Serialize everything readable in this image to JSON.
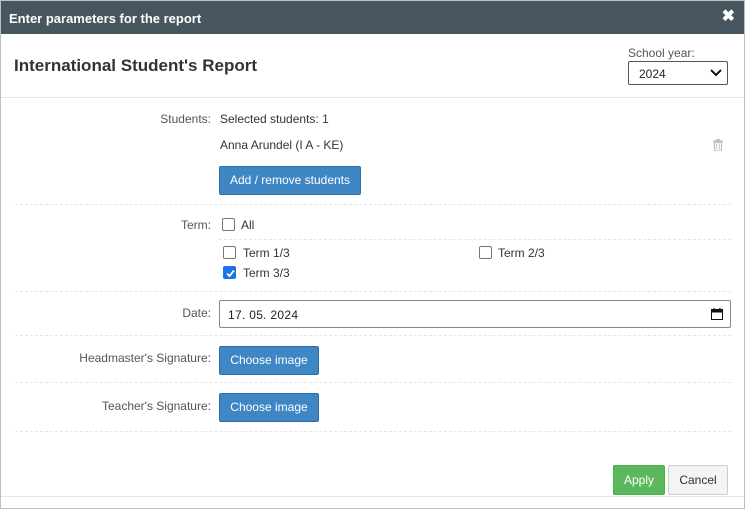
{
  "dialog": {
    "title": "Enter parameters for the report",
    "close_glyph": "✖"
  },
  "header": {
    "report_title": "International Student's Report",
    "school_year_label": "School year:",
    "school_year_value": "2024"
  },
  "students": {
    "label": "Students:",
    "selected_text": "Selected students: 1",
    "items": [
      {
        "name": "Anna Arundel (I A - KE)",
        "delete_icon": "trash-icon"
      }
    ],
    "add_remove_label": "Add / remove students"
  },
  "term": {
    "label": "Term:",
    "all_label": "All",
    "all_checked": false,
    "options": [
      {
        "label": "Term 1/3",
        "checked": false
      },
      {
        "label": "Term 2/3",
        "checked": false
      },
      {
        "label": "Term 3/3",
        "checked": true
      }
    ]
  },
  "date": {
    "label": "Date:",
    "value": "17. 05. 2024"
  },
  "signatures": {
    "headmaster_label": "Headmaster's Signature:",
    "teacher_label": "Teacher's Signature:",
    "choose_image_label": "Choose image"
  },
  "footer": {
    "apply_label": "Apply",
    "cancel_label": "Cancel"
  },
  "colors": {
    "titlebar": "#47555f",
    "primary_button": "#3e86c4",
    "apply_button": "#5cb85c",
    "checkbox_checked": "#1a73e8"
  }
}
